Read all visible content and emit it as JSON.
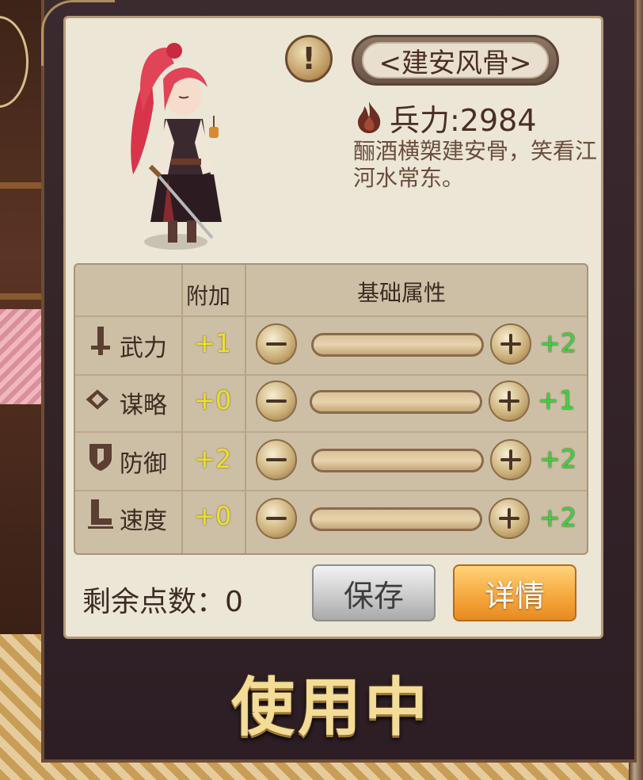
{
  "general": {
    "name": "<建安风骨>",
    "troops_label": "兵力:2984",
    "quote": "酾酒横槊建安骨，笑看江河水常东。"
  },
  "table": {
    "header_bonus": "附加",
    "header_base": "基础属性",
    "rows": [
      {
        "label": "武力",
        "icon": "sword-icon",
        "bonus": "+1",
        "base": "+2"
      },
      {
        "label": "谋略",
        "icon": "strategy-icon",
        "bonus": "+0",
        "base": "+1"
      },
      {
        "label": "防御",
        "icon": "shield-icon",
        "bonus": "+2",
        "base": "+2"
      },
      {
        "label": "速度",
        "icon": "boot-icon",
        "bonus": "+0",
        "base": "+2"
      }
    ]
  },
  "footer": {
    "remaining_label": "剩余点数：0",
    "save_label": "保存",
    "detail_label": "详情"
  },
  "status": {
    "in_use_label": "使用中"
  },
  "colors": {
    "bonus": "#ece032",
    "base": "#3ed23a",
    "detail_button": "#f5a53a"
  }
}
